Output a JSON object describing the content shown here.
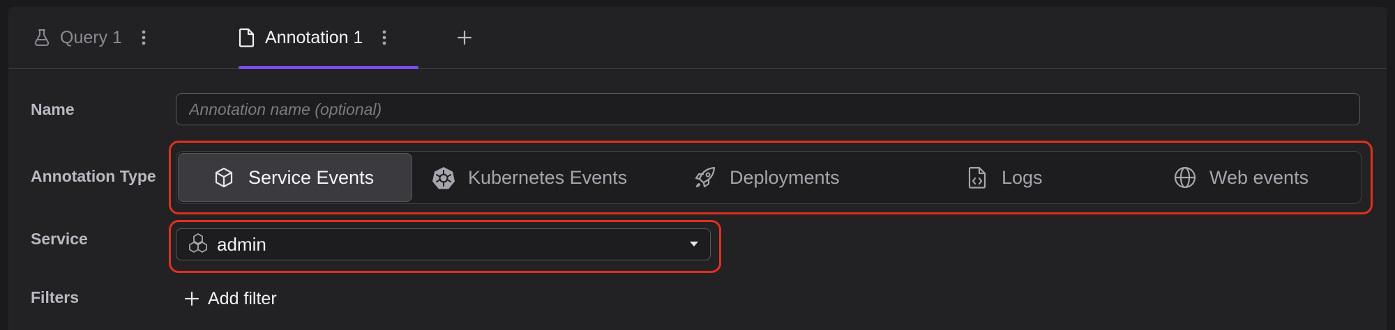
{
  "tabs": [
    {
      "label": "Query 1",
      "icon": "flask-icon",
      "active": false
    },
    {
      "label": "Annotation 1",
      "icon": "file-icon",
      "active": true
    }
  ],
  "colors": {
    "accent": "#7c4dff",
    "highlight": "#e0301e",
    "background": "#222225"
  },
  "form": {
    "name": {
      "label": "Name",
      "placeholder": "Annotation name (optional)",
      "value": ""
    },
    "annotation_type": {
      "label": "Annotation Type",
      "options": [
        {
          "label": "Service Events",
          "icon": "cube-icon",
          "selected": true
        },
        {
          "label": "Kubernetes Events",
          "icon": "kubernetes-icon",
          "selected": false
        },
        {
          "label": "Deployments",
          "icon": "rocket-icon",
          "selected": false
        },
        {
          "label": "Logs",
          "icon": "file-code-icon",
          "selected": false
        },
        {
          "label": "Web events",
          "icon": "globe-icon",
          "selected": false
        }
      ]
    },
    "service": {
      "label": "Service",
      "value": "admin",
      "icon": "services-icon"
    },
    "filters": {
      "label": "Filters",
      "add_label": "Add filter"
    }
  }
}
